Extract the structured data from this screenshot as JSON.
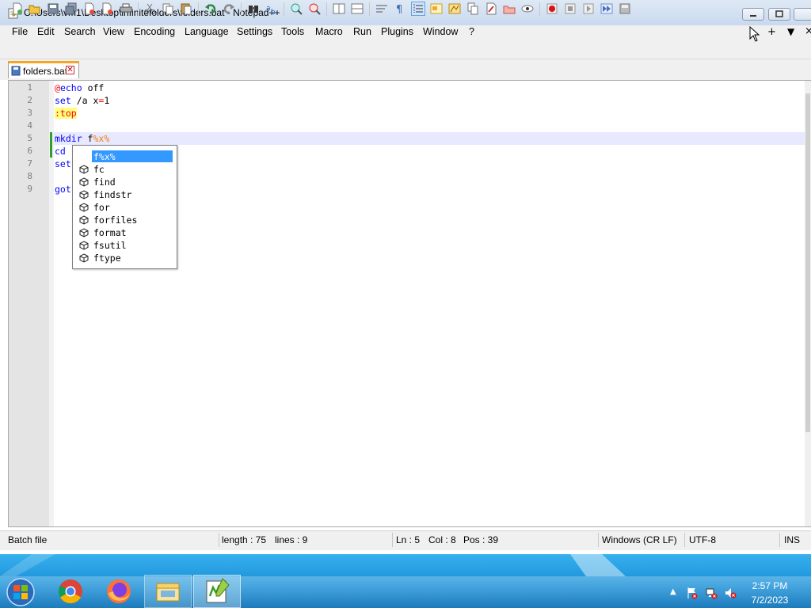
{
  "window": {
    "title": "C:\\Users\\vm1\\Desktop\\infinitefolders\\folders.bat - Notepad++"
  },
  "menu": {
    "items": [
      "File",
      "Edit",
      "Search",
      "View",
      "Encoding",
      "Language",
      "Settings",
      "Tools",
      "Macro",
      "Run",
      "Plugins",
      "Window",
      "?"
    ],
    "right_plus": "+",
    "right_down": "▼",
    "right_close": "×"
  },
  "toolbar": {
    "icons": [
      "new-file-icon",
      "open-file-icon",
      "save-icon",
      "save-all-icon",
      "close-icon",
      "close-all-icon",
      "print-icon",
      "cut-icon",
      "copy-icon",
      "paste-icon",
      "undo-icon",
      "redo-icon",
      "find-icon",
      "replace-icon",
      "zoom-in-icon",
      "zoom-out-icon",
      "sync-vertical-icon",
      "sync-horizontal-icon",
      "word-wrap-icon",
      "show-all-chars-icon",
      "indent-guide-icon",
      "user-defined-language-icon",
      "document-map-icon",
      "function-list-icon",
      "folder-workspace-icon",
      "monitoring-icon",
      "record-macro-icon",
      "stop-macro-icon",
      "play-macro-icon",
      "run-macro-multiple-icon",
      "save-macro-icon"
    ]
  },
  "tab": {
    "label": "folders.bat",
    "close": "✕"
  },
  "editor": {
    "lines": [
      {
        "num": "1",
        "segments": [
          {
            "t": "@",
            "c": "op"
          },
          {
            "t": "echo",
            "c": "kw"
          },
          {
            "t": " off",
            "c": ""
          }
        ]
      },
      {
        "num": "2",
        "segments": [
          {
            "t": "set",
            "c": "kw"
          },
          {
            "t": " /a x",
            "c": ""
          },
          {
            "t": "=",
            "c": "op"
          },
          {
            "t": "1",
            "c": ""
          }
        ]
      },
      {
        "num": "3",
        "segments": [
          {
            "t": ":top",
            "c": "lbl"
          }
        ]
      },
      {
        "num": "4",
        "segments": []
      },
      {
        "num": "5",
        "segments": [
          {
            "t": "mkdir",
            "c": "kw"
          },
          {
            "t": " f",
            "c": ""
          },
          {
            "t": "%x%",
            "c": "var"
          }
        ]
      },
      {
        "num": "6",
        "segments": [
          {
            "t": "cd",
            "c": "kw"
          }
        ]
      },
      {
        "num": "7",
        "segments": [
          {
            "t": "set",
            "c": "kw"
          }
        ]
      },
      {
        "num": "8",
        "segments": []
      },
      {
        "num": "9",
        "segments": [
          {
            "t": "got",
            "c": "kw"
          }
        ]
      }
    ]
  },
  "autocomplete": {
    "items": [
      "f%x%",
      "fc",
      "find",
      "findstr",
      "for",
      "forfiles",
      "format",
      "fsutil",
      "ftype"
    ],
    "selected_index": 0
  },
  "status": {
    "language": "Batch file",
    "length": "length : 75",
    "lines": "lines : 9",
    "ln": "Ln : 5",
    "col": "Col : 8",
    "pos": "Pos : 39",
    "eol": "Windows (CR LF)",
    "encoding": "UTF-8",
    "mode": "INS"
  },
  "taskbar": {
    "apps": [
      "chrome-icon",
      "firefox-icon",
      "file-explorer-icon",
      "notepadpp-icon"
    ],
    "time": "2:57 PM",
    "date": "7/2/2023",
    "tray_arrow": "▲"
  },
  "colors": {
    "keyword": "#0000ff",
    "label_bg": "#ffff80",
    "variable": "#f08000",
    "selection": "#3399ff",
    "taskbar": "#1a8fd6"
  }
}
